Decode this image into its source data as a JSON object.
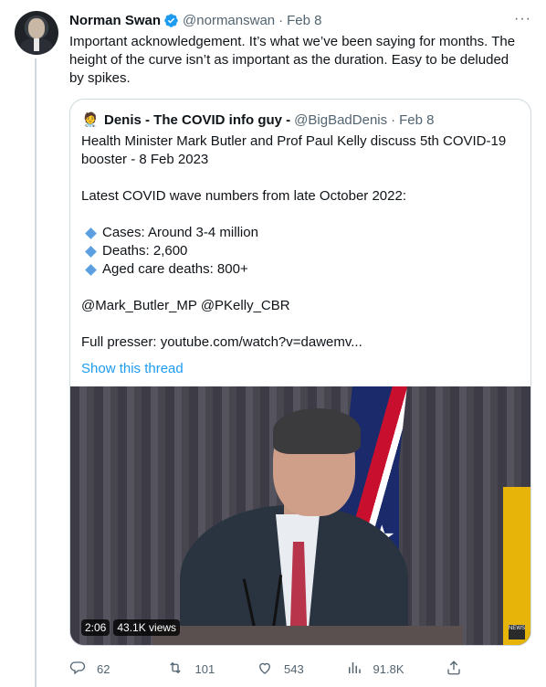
{
  "tweet": {
    "author_name": "Norman Swan",
    "handle": "@normanswan",
    "separator": "·",
    "date": "Feb 8",
    "more_label": "···",
    "text": "Important acknowledgement. It’s what we’ve been saying for months. The height of the curve isn’t as important as the duration. Easy to be deluded by spikes."
  },
  "quote": {
    "avatar_glyph": "🧑‍⚕️",
    "author_name": "Denis - The COVID info guy -",
    "handle": "@BigBadDenis",
    "separator": "·",
    "date": "Feb 8",
    "line1": "Health Minister Mark Butler and Prof Paul Kelly discuss 5th COVID-19 booster - 8 Feb 2023",
    "line2": "Latest COVID wave numbers from late October 2022:",
    "bullets": [
      "Cases: Around 3-4 million",
      "Deaths: 2,600",
      "Aged care deaths: 800+"
    ],
    "mentions": "@Mark_Butler_MP @PKelly_CBR",
    "presser": "Full presser: youtube.com/watch?v=dawemv...",
    "show_thread": "Show this thread",
    "video": {
      "duration": "2:06",
      "views": "43.1K views",
      "logo_text": "NEWS"
    }
  },
  "actions": {
    "replies": "62",
    "retweets": "101",
    "likes": "543",
    "views": "91.8K"
  },
  "colors": {
    "accent": "#1d9bf0",
    "secondary_text": "#536471",
    "border": "#cfd9de"
  }
}
